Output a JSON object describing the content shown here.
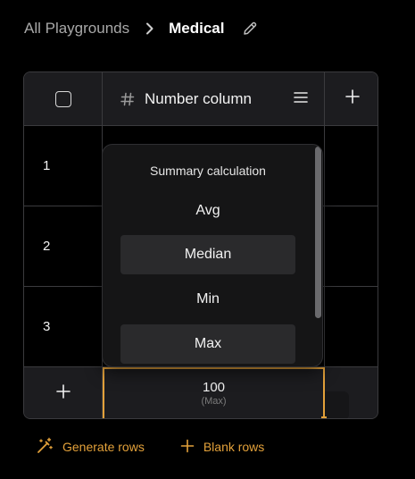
{
  "breadcrumb": {
    "root": "All Playgrounds",
    "current": "Medical"
  },
  "table": {
    "column": {
      "title": "Number column",
      "type_icon": "hash-icon"
    },
    "rows": [
      {
        "number": "1"
      },
      {
        "number": "2"
      },
      {
        "number": "3"
      }
    ],
    "summary": {
      "value": "100",
      "label": "(Max)"
    }
  },
  "summary_menu": {
    "title": "Summary calculation",
    "options": [
      {
        "label": "Avg"
      },
      {
        "label": "Median"
      },
      {
        "label": "Min"
      },
      {
        "label": "Max"
      }
    ]
  },
  "actions": {
    "generate_rows": "Generate rows",
    "blank_rows": "Blank rows"
  },
  "colors": {
    "accent": "#e3a13a",
    "background": "#000000",
    "header": "#1c1c1f",
    "border": "#3b3b3e"
  }
}
